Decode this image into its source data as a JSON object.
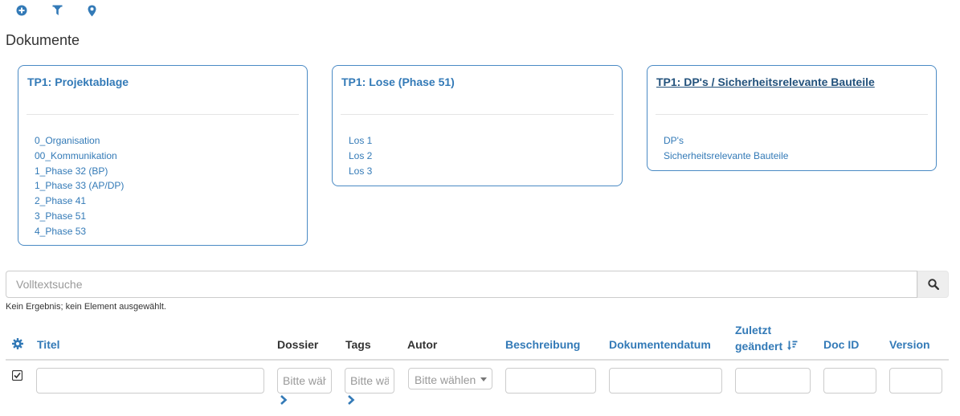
{
  "toolbar": {
    "icons": [
      "plus-circle-icon",
      "filter-icon",
      "map-marker-icon"
    ]
  },
  "page_title": "Dokumente",
  "panels": [
    {
      "title": "TP1: Projektablage",
      "underlined": false,
      "links": [
        "0_Organisation",
        "00_Kommunikation",
        "1_Phase 32 (BP)",
        "1_Phase 33 (AP/DP)",
        "2_Phase 41",
        "3_Phase 51",
        "4_Phase 53"
      ]
    },
    {
      "title": "TP1: Lose (Phase 51)",
      "underlined": false,
      "links": [
        "Los 1",
        "Los 2",
        "Los 3"
      ]
    },
    {
      "title": "TP1: DP's / Sicherheitsrelevante Bauteile",
      "underlined": true,
      "links": [
        "DP's",
        "Sicherheitsrelevante Bauteile"
      ]
    }
  ],
  "search": {
    "placeholder": "Volltextsuche",
    "value": "",
    "button_icon": "search-icon"
  },
  "status": "Kein Ergebnis; kein Element ausgewählt.",
  "table": {
    "settings_icon": "gear-icon",
    "columns": {
      "titel": "Titel",
      "dossier": "Dossier",
      "tags": "Tags",
      "autor": "Autor",
      "beschreibung": "Beschreibung",
      "dokumentendatum": "Dokumentendatum",
      "zuletzt_line1": "Zuletzt",
      "zuletzt_line2": "geändert",
      "doc_id": "Doc ID",
      "version": "Version"
    },
    "sort_icon": "sort-amount-desc-icon",
    "filters": {
      "titel": "",
      "dossier_placeholder": "Bitte wäh",
      "tags_placeholder": "Bitte wä",
      "autor_select": "Bitte wählen",
      "beschreibung": "",
      "dokumentendatum": "",
      "zuletzt": "",
      "doc_id": "",
      "version": ""
    },
    "select_all_checked": true
  },
  "colors": {
    "link": "#337ab7",
    "panel_border": "#4a8ac4",
    "text": "#333333"
  }
}
